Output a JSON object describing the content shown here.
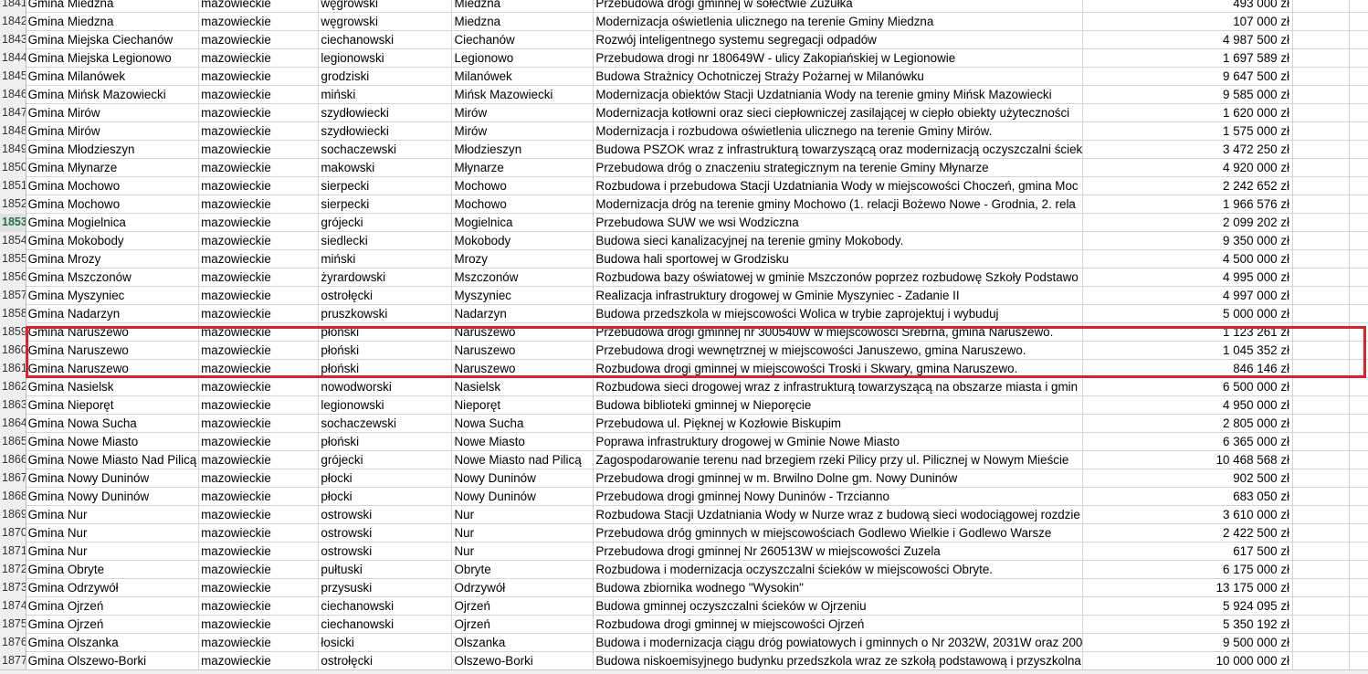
{
  "spreadsheet": {
    "active_row": "1853",
    "highlight_color": "#e0212b",
    "rows": [
      {
        "num": "1841",
        "gmina": "Gmina Miedzna",
        "woj": "mazowieckie",
        "powiat": "węgrowski",
        "miejsc": "Miedzna",
        "opis": "Przebudowa drogi gminnej w sołectwie Żużułka",
        "kwota": "493 000 zł"
      },
      {
        "num": "1842",
        "gmina": "Gmina Miedzna",
        "woj": "mazowieckie",
        "powiat": "węgrowski",
        "miejsc": "Miedzna",
        "opis": "Modernizacja oświetlenia ulicznego na terenie Gminy Miedzna",
        "kwota": "107 000 zł"
      },
      {
        "num": "1843",
        "gmina": "Gmina Miejska Ciechanów",
        "woj": "mazowieckie",
        "powiat": "ciechanowski",
        "miejsc": "Ciechanów",
        "opis": "Rozwój inteligentnego systemu segregacji odpadów",
        "kwota": "4 987 500 zł"
      },
      {
        "num": "1844",
        "gmina": "Gmina Miejska Legionowo",
        "woj": "mazowieckie",
        "powiat": "legionowski",
        "miejsc": "Legionowo",
        "opis": "Przebudowa drogi nr 180649W - ulicy Zakopiańskiej w Legionowie",
        "kwota": "1 697 589 zł"
      },
      {
        "num": "1845",
        "gmina": "Gmina Milanówek",
        "woj": "mazowieckie",
        "powiat": "grodziski",
        "miejsc": "Milanówek",
        "opis": "Budowa Strażnicy Ochotniczej Straży Pożarnej w Milanówku",
        "kwota": "9 647 500 zł"
      },
      {
        "num": "1846",
        "gmina": "Gmina Mińsk Mazowiecki",
        "woj": "mazowieckie",
        "powiat": "miński",
        "miejsc": "Mińsk Mazowiecki",
        "opis": "Modernizacja obiektów Stacji Uzdatniania Wody na terenie gminy Mińsk Mazowiecki",
        "kwota": "9 585 000 zł"
      },
      {
        "num": "1847",
        "gmina": "Gmina Mirów",
        "woj": "mazowieckie",
        "powiat": "szydłowiecki",
        "miejsc": "Mirów",
        "opis": "Modernizacja kotłowni oraz sieci ciepłowniczej zasilającej w ciepło obiekty użyteczności",
        "kwota": "1 620 000 zł"
      },
      {
        "num": "1848",
        "gmina": "Gmina Mirów",
        "woj": "mazowieckie",
        "powiat": "szydłowiecki",
        "miejsc": "Mirów",
        "opis": "Modernizacja i rozbudowa oświetlenia ulicznego na terenie Gminy Mirów.",
        "kwota": "1 575 000 zł"
      },
      {
        "num": "1849",
        "gmina": "Gmina Młodzieszyn",
        "woj": "mazowieckie",
        "powiat": "sochaczewski",
        "miejsc": "Młodzieszyn",
        "opis": "Budowa PSZOK wraz z infrastrukturą towarzyszącą oraz modernizacją oczyszczalni ściekó",
        "kwota": "3 472 250 zł"
      },
      {
        "num": "1850",
        "gmina": "Gmina Młynarze",
        "woj": "mazowieckie",
        "powiat": "makowski",
        "miejsc": "Młynarze",
        "opis": "Przebudowa dróg o znaczeniu strategicznym na terenie Gminy Młynarze",
        "kwota": "4 920 000 zł"
      },
      {
        "num": "1851",
        "gmina": "Gmina Mochowo",
        "woj": "mazowieckie",
        "powiat": "sierpecki",
        "miejsc": "Mochowo",
        "opis": "Rozbudowa i przebudowa Stacji Uzdatniania Wody w miejscowości Choczeń, gmina Moc",
        "kwota": "2 242 652 zł"
      },
      {
        "num": "1852",
        "gmina": "Gmina Mochowo",
        "woj": "mazowieckie",
        "powiat": "sierpecki",
        "miejsc": "Mochowo",
        "opis": "Modernizacja dróg na terenie gminy Mochowo (1. relacji Bożewo Nowe - Grodnia, 2. rela",
        "kwota": "1 966 576 zł"
      },
      {
        "num": "1853",
        "gmina": "Gmina Mogielnica",
        "woj": "mazowieckie",
        "powiat": "grójecki",
        "miejsc": "Mogielnica",
        "opis": "Przebudowa SUW we wsi Wodziczna",
        "kwota": "2 099 202 zł"
      },
      {
        "num": "1854",
        "gmina": "Gmina Mokobody",
        "woj": "mazowieckie",
        "powiat": "siedlecki",
        "miejsc": "Mokobody",
        "opis": "Budowa sieci kanalizacyjnej na terenie gminy Mokobody.",
        "kwota": "9 350 000 zł"
      },
      {
        "num": "1855",
        "gmina": "Gmina Mrozy",
        "woj": "mazowieckie",
        "powiat": "miński",
        "miejsc": "Mrozy",
        "opis": "Budowa hali sportowej w Grodzisku",
        "kwota": "4 500 000 zł"
      },
      {
        "num": "1856",
        "gmina": "Gmina Mszczonów",
        "woj": "mazowieckie",
        "powiat": "żyrardowski",
        "miejsc": "Mszczonów",
        "opis": "Rozbudowa bazy oświatowej w gminie Mszczonów poprzez rozbudowę Szkoły Podstawo",
        "kwota": "4 995 000 zł"
      },
      {
        "num": "1857",
        "gmina": "Gmina Myszyniec",
        "woj": "mazowieckie",
        "powiat": "ostrołęcki",
        "miejsc": "Myszyniec",
        "opis": "Realizacja infrastruktury drogowej w Gminie Myszyniec - Zadanie II",
        "kwota": "4 997 000 zł"
      },
      {
        "num": "1858",
        "gmina": "Gmina Nadarzyn",
        "woj": "mazowieckie",
        "powiat": "pruszkowski",
        "miejsc": "Nadarzyn",
        "opis": "Budowa przedszkola w miejscowości Wolica w trybie zaprojektuj i wybuduj",
        "kwota": "5 000 000 zł"
      },
      {
        "num": "1859",
        "gmina": "Gmina Naruszewo",
        "woj": "mazowieckie",
        "powiat": "płoński",
        "miejsc": "Naruszewo",
        "opis": "Przebudowa drogi gminnej nr 300540W w miejscowości Srebrna, gmina Naruszewo.",
        "kwota": "1 123 261 zł"
      },
      {
        "num": "1860",
        "gmina": "Gmina Naruszewo",
        "woj": "mazowieckie",
        "powiat": "płoński",
        "miejsc": "Naruszewo",
        "opis": "Przebudowa drogi wewnętrznej w miejscowości Januszewo, gmina Naruszewo.",
        "kwota": "1 045 352 zł"
      },
      {
        "num": "1861",
        "gmina": "Gmina Naruszewo",
        "woj": "mazowieckie",
        "powiat": "płoński",
        "miejsc": "Naruszewo",
        "opis": "Rozbudowa drogi gminnej w miejscowości Troski i Skwary, gmina Naruszewo.",
        "kwota": "846 146 zł"
      },
      {
        "num": "1862",
        "gmina": "Gmina Nasielsk",
        "woj": "mazowieckie",
        "powiat": "nowodworski",
        "miejsc": "Nasielsk",
        "opis": "Rozbudowa sieci drogowej wraz z infrastrukturą towarzyszącą na obszarze miasta i gmin",
        "kwota": "6 500 000 zł"
      },
      {
        "num": "1863",
        "gmina": "Gmina Nieporęt",
        "woj": "mazowieckie",
        "powiat": "legionowski",
        "miejsc": "Nieporęt",
        "opis": "Budowa biblioteki gminnej w Nieporęcie",
        "kwota": "4 950 000 zł"
      },
      {
        "num": "1864",
        "gmina": "Gmina Nowa Sucha",
        "woj": "mazowieckie",
        "powiat": "sochaczewski",
        "miejsc": "Nowa Sucha",
        "opis": "Przebudowa ul. Pięknej w Kozłowie Biskupim",
        "kwota": "2 805 000 zł"
      },
      {
        "num": "1865",
        "gmina": "Gmina Nowe Miasto",
        "woj": "mazowieckie",
        "powiat": "płoński",
        "miejsc": "Nowe Miasto",
        "opis": "Poprawa infrastruktury drogowej w Gminie Nowe Miasto",
        "kwota": "6 365 000 zł"
      },
      {
        "num": "1866",
        "gmina": "Gmina Nowe Miasto Nad Pilicą",
        "woj": "mazowieckie",
        "powiat": "grójecki",
        "miejsc": "Nowe Miasto nad Pilicą",
        "opis": "Zagospodarowanie terenu nad brzegiem rzeki Pilicy przy ul. Pilicznej w Nowym Mieście",
        "kwota": "10 468 568 zł"
      },
      {
        "num": "1867",
        "gmina": "Gmina Nowy Duninów",
        "woj": "mazowieckie",
        "powiat": "płocki",
        "miejsc": "Nowy Duninów",
        "opis": "Przebudowa drogi gminnej w m. Brwilno Dolne gm. Nowy Duninów",
        "kwota": "902 500 zł"
      },
      {
        "num": "1868",
        "gmina": "Gmina Nowy Duninów",
        "woj": "mazowieckie",
        "powiat": "płocki",
        "miejsc": "Nowy Duninów",
        "opis": "Przebudowa drogi gminnej Nowy Duninów - Trzcianno",
        "kwota": "683 050 zł"
      },
      {
        "num": "1869",
        "gmina": "Gmina Nur",
        "woj": "mazowieckie",
        "powiat": "ostrowski",
        "miejsc": "Nur",
        "opis": "Rozbudowa Stacji Uzdatniania Wody w Nurze wraz z budową sieci wodociągowej rozdzie",
        "kwota": "3 610 000 zł"
      },
      {
        "num": "1870",
        "gmina": "Gmina Nur",
        "woj": "mazowieckie",
        "powiat": "ostrowski",
        "miejsc": "Nur",
        "opis": "Przebudowa dróg gminnych w miejscowościach Godlewo Wielkie i Godlewo Warsze",
        "kwota": "2 422 500 zł"
      },
      {
        "num": "1871",
        "gmina": "Gmina Nur",
        "woj": "mazowieckie",
        "powiat": "ostrowski",
        "miejsc": "Nur",
        "opis": "Przebudowa drogi gminnej Nr 260513W w miejscowości Zuzela",
        "kwota": "617 500 zł"
      },
      {
        "num": "1872",
        "gmina": "Gmina Obryte",
        "woj": "mazowieckie",
        "powiat": "pułtuski",
        "miejsc": "Obryte",
        "opis": "Rozbudowa i modernizacja oczyszczalni ścieków w miejscowości Obryte.",
        "kwota": "6 175 000 zł"
      },
      {
        "num": "1873",
        "gmina": "Gmina Odrzywół",
        "woj": "mazowieckie",
        "powiat": "przysuski",
        "miejsc": "Odrzywół",
        "opis": "Budowa zbiornika wodnego \"Wysokin\"",
        "kwota": "13 175 000 zł"
      },
      {
        "num": "1874",
        "gmina": "Gmina Ojrzeń",
        "woj": "mazowieckie",
        "powiat": "ciechanowski",
        "miejsc": "Ojrzeń",
        "opis": "Budowa gminnej oczyszczalni ścieków w Ojrzeniu",
        "kwota": "5 924 095 zł"
      },
      {
        "num": "1875",
        "gmina": "Gmina Ojrzeń",
        "woj": "mazowieckie",
        "powiat": "ciechanowski",
        "miejsc": "Ojrzeń",
        "opis": "Rozbudowa drogi gminnej w miejscowości Ojrzeń",
        "kwota": "5 350 192 zł"
      },
      {
        "num": "1876",
        "gmina": "Gmina Olszanka",
        "woj": "mazowieckie",
        "powiat": "łosicki",
        "miejsc": "Olszanka",
        "opis": "Budowa i modernizacja ciągu dróg powiatowych i gminnych o Nr 2032W, 2031W oraz 200",
        "kwota": "9 500 000 zł"
      },
      {
        "num": "1877",
        "gmina": "Gmina Olszewo-Borki",
        "woj": "mazowieckie",
        "powiat": "ostrołęcki",
        "miejsc": "Olszewo-Borki",
        "opis": "Budowa niskoemisyjnego budynku przedszkola wraz ze szkołą podstawową i przyszkolna",
        "kwota": "10 000 000 zł"
      }
    ]
  }
}
